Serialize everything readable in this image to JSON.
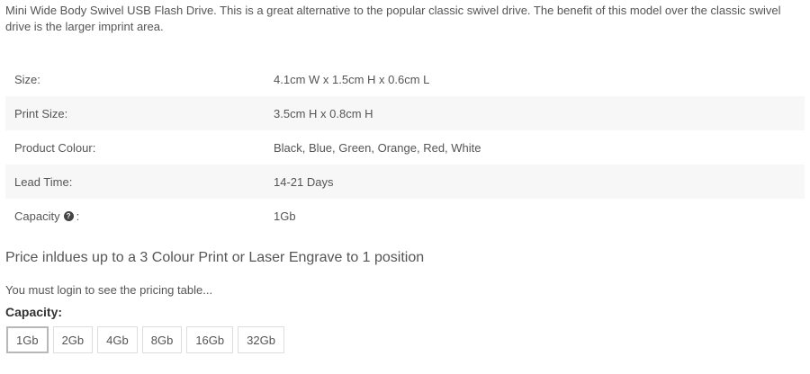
{
  "description": "Mini Wide Body Swivel USB Flash Drive. This is a great alternative to the popular classic swivel drive. The benefit of this model over the classic swivel drive is the larger imprint area.",
  "specs": [
    {
      "label": "Size:",
      "value": "4.1cm W x 1.5cm H x 0.6cm L"
    },
    {
      "label": "Print Size:",
      "value": "3.5cm H x 0.8cm H"
    },
    {
      "label": "Product Colour:",
      "value": "Black, Blue, Green, Orange, Red, White"
    },
    {
      "label": "Lead Time:",
      "value": "14-21 Days"
    },
    {
      "label": "Capacity",
      "help_icon": "question-circle-icon",
      "colon": ":",
      "value": "1Gb"
    }
  ],
  "price_note": "Price inldues up to a 3 Colour Print or Laser Engrave to 1 position",
  "login_note": "You must login to see the pricing table...",
  "capacity": {
    "heading": "Capacity:",
    "options": [
      "1Gb",
      "2Gb",
      "4Gb",
      "8Gb",
      "16Gb",
      "32Gb"
    ],
    "selected": "1Gb"
  }
}
